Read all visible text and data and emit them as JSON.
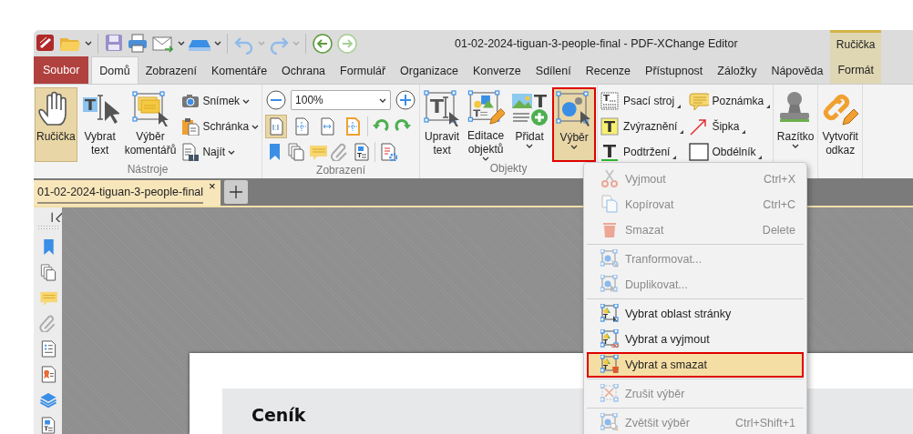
{
  "window": {
    "title": "01-02-2024-tiguan-3-people-final - PDF-XChange Editor"
  },
  "contextual_tab": {
    "group": "Ručička",
    "label": "Formát",
    "selected": false
  },
  "ribbon_tabs": [
    {
      "label": "Soubor",
      "kind": "file",
      "selected": false
    },
    {
      "label": "Domů",
      "kind": "tab",
      "selected": true
    },
    {
      "label": "Zobrazení",
      "kind": "tab",
      "selected": false
    },
    {
      "label": "Komentáře",
      "kind": "tab",
      "selected": false
    },
    {
      "label": "Ochrana",
      "kind": "tab",
      "selected": false
    },
    {
      "label": "Formulář",
      "kind": "tab",
      "selected": false
    },
    {
      "label": "Organizace",
      "kind": "tab",
      "selected": false
    },
    {
      "label": "Konverze",
      "kind": "tab",
      "selected": false
    },
    {
      "label": "Sdílení",
      "kind": "tab",
      "selected": false
    },
    {
      "label": "Recenze",
      "kind": "tab",
      "selected": false
    },
    {
      "label": "Přístupnost",
      "kind": "tab",
      "selected": false
    },
    {
      "label": "Záložky",
      "kind": "tab",
      "selected": false
    },
    {
      "label": "Nápověda",
      "kind": "tab",
      "selected": false
    }
  ],
  "ribbon_groups": [
    {
      "title": "Nástroje",
      "kind": "tools",
      "items": [
        {
          "label": "Ručička",
          "dropdown": false,
          "selected": true
        },
        {
          "label": "Vybrat text",
          "dropdown": false,
          "selected": false
        },
        {
          "label": "Výběr komentářů",
          "dropdown": false,
          "selected": false
        }
      ],
      "small_items": [
        {
          "label": "Snímek",
          "dropdown": true
        },
        {
          "label": "Schránka",
          "dropdown": true
        },
        {
          "label": "Najít",
          "dropdown": true
        }
      ]
    },
    {
      "title": "Zobrazení",
      "kind": "view",
      "zoom_value": "100%",
      "view_buttons": [
        {
          "selected": true
        },
        {
          "selected": false
        },
        {
          "selected": false
        },
        {
          "selected": false
        }
      ]
    },
    {
      "title": "Objekty",
      "kind": "objects",
      "items": [
        {
          "label": "Upravit text",
          "dropdown": false,
          "selected": false
        },
        {
          "label": "Editace objektů",
          "dropdown": true,
          "selected": false
        },
        {
          "label": "Přidat",
          "dropdown": true,
          "selected": false
        },
        {
          "label": "Výběr",
          "dropdown": true,
          "selected": true
        }
      ]
    },
    {
      "kind": "comments",
      "small_items": [
        {
          "label": "Psací stroj",
          "dropdown": true
        },
        {
          "label": "Poznámka",
          "dropdown": true
        },
        {
          "label": "Zvýraznění",
          "dropdown": true
        },
        {
          "label": "Šipka",
          "dropdown": true
        },
        {
          "label": "Podtržení",
          "dropdown": true
        },
        {
          "label": "Obdélník",
          "dropdown": true
        }
      ]
    },
    {
      "kind": "stamp",
      "items": [
        {
          "label": "Razítko",
          "dropdown": true,
          "selected": false
        }
      ]
    },
    {
      "kind": "link",
      "items": [
        {
          "label": "Vytvořit odkaz",
          "dropdown": false,
          "selected": false
        }
      ]
    }
  ],
  "document_tabs": [
    {
      "label": "01-02-2024-tiguan-3-people-final",
      "selected": true,
      "close": "×"
    }
  ],
  "document": {
    "heading": "Ceník"
  },
  "context_menu": {
    "items": [
      {
        "kind": "item",
        "label": "Vyjmout",
        "shortcut": "Ctrl+X",
        "disabled": true,
        "selected": false
      },
      {
        "kind": "item",
        "label": "Kopírovat",
        "shortcut": "Ctrl+C",
        "disabled": true,
        "selected": false
      },
      {
        "kind": "item",
        "label": "Smazat",
        "shortcut": "Delete",
        "disabled": true,
        "selected": false
      },
      {
        "kind": "separator"
      },
      {
        "kind": "item",
        "label": "Tranformovat...",
        "disabled": true,
        "selected": false
      },
      {
        "kind": "item",
        "label": "Duplikovat...",
        "disabled": true,
        "selected": false
      },
      {
        "kind": "separator"
      },
      {
        "kind": "item",
        "label": "Vybrat oblast stránky",
        "disabled": false,
        "selected": false
      },
      {
        "kind": "item",
        "label": "Vybrat a vyjmout",
        "disabled": false,
        "selected": false
      },
      {
        "kind": "item",
        "label": "Vybrat a smazat",
        "disabled": false,
        "selected": true
      },
      {
        "kind": "separator"
      },
      {
        "kind": "item",
        "label": "Zrušit výběr",
        "disabled": true,
        "selected": false
      },
      {
        "kind": "separator"
      },
      {
        "kind": "item",
        "label": "Zvětšit výběr",
        "shortcut": "Ctrl+Shift+1",
        "disabled": true,
        "selected": false
      }
    ]
  }
}
